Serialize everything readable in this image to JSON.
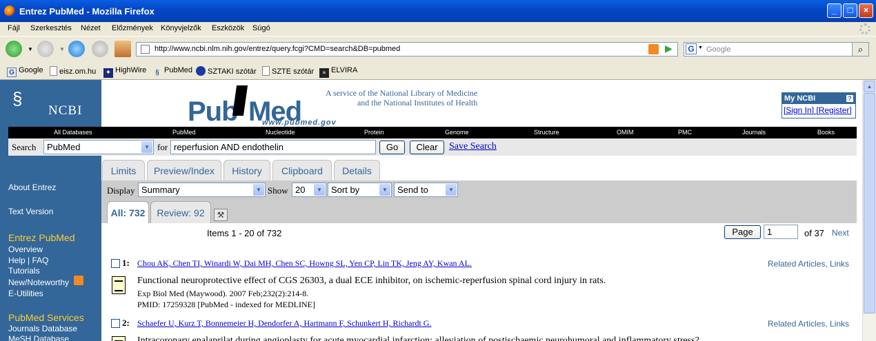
{
  "window": {
    "title": "Entrez PubMed - Mozilla Firefox"
  },
  "menu": [
    "Fájl",
    "Szerkesztés",
    "Nézet",
    "Előzmények",
    "Könyvjelzők",
    "Eszközök",
    "Súgó"
  ],
  "address": {
    "url": "http://www.ncbi.nlm.nih.gov/entrez/query.fcgi?CMD=search&DB=pubmed"
  },
  "google_search": {
    "placeholder": "Google"
  },
  "bookmarks": [
    "Google",
    "eisz.om.hu",
    "HighWire",
    "PubMed",
    "SZTAKI szótár",
    "SZTE szótár",
    "ELVIRA"
  ],
  "ncbi": {
    "logo_text": "NCBI",
    "service_line1": "A service of the National Library of Medicine",
    "service_line2": "and the National Institutes of Health",
    "pubmed_logo": {
      "pub": "Pub",
      "med": "Med",
      "www": "www.pubmed.gov"
    },
    "myncbi": {
      "title": "My NCBI",
      "help": "?",
      "sign_in": "[Sign In]",
      "register": "[Register]"
    }
  },
  "databases": [
    "All Databases",
    "PubMed",
    "Nucleotide",
    "Protein",
    "Genome",
    "Structure",
    "OMIM",
    "PMC",
    "Journals",
    "Books"
  ],
  "search": {
    "label": "Search",
    "db": "PubMed",
    "for_label": "for",
    "query": "reperfusion AND endothelin",
    "go": "Go",
    "clear": "Clear",
    "save": "Save Search"
  },
  "tabs": [
    "Limits",
    "Preview/Index",
    "History",
    "Clipboard",
    "Details"
  ],
  "display": {
    "label": "Display",
    "value": "Summary",
    "show_label": "Show",
    "show_value": "20",
    "sort": "Sort by",
    "send": "Send to"
  },
  "subtabs": {
    "all": "All: 732",
    "review": "Review: 92"
  },
  "paging": {
    "items": "Items 1 - 20 of 732",
    "page_button": "Page",
    "page_value": "1",
    "of": "of 37",
    "next": "Next"
  },
  "sidebar": {
    "about": "About Entrez",
    "text_version": "Text Version",
    "entrez_head": "Entrez PubMed",
    "entrez_items": [
      "Overview",
      "Help | FAQ",
      "Tutorials",
      "New/Noteworthy",
      "E-Utilities"
    ],
    "services_head": "PubMed Services",
    "services_items": [
      "Journals Database",
      "MeSH Database"
    ]
  },
  "results": [
    {
      "num": "1:",
      "authors": "Chou AK, Chen TI, Winardi W, Dai MH, Chen SC, Howng SL, Yen CP, Lin TK, Jeng AY, Kwan AL.",
      "related": "Related Articles, Links",
      "title": "Functional neuroprotective effect of CGS 26303, a dual ECE inhibitor, on ischemic-reperfusion spinal cord injury in rats.",
      "source": "Exp Biol Med (Maywood). 2007 Feb;232(2):214-8.",
      "pmid": "PMID: 17259328 [PubMed - indexed for MEDLINE]"
    },
    {
      "num": "2:",
      "authors": "Schaefer U, Kurz T, Bonnemeier H, Dendorfer A, Hartmann F, Schunkert H, Richardt G.",
      "related": "Related Articles, Links",
      "title": "Intracoronary enalaprilat during angioplasty for acute myocardial infarction: alleviation of postischaemic neurohumoral and inflammatory stress?",
      "source": "",
      "pmid": ""
    }
  ]
}
